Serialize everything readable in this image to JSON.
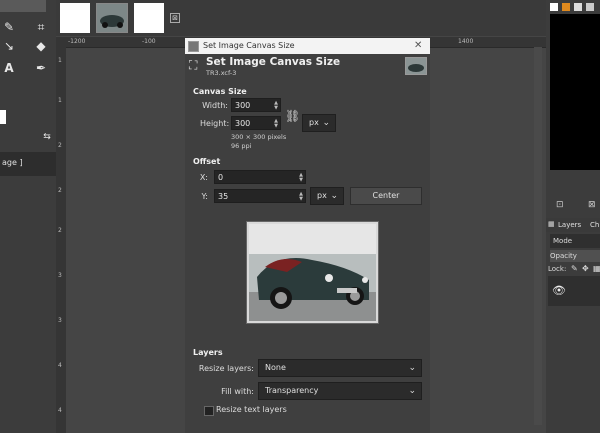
{
  "toolbox": {
    "tool_label": "age ]"
  },
  "tabs": {
    "close_glyph": "⊠"
  },
  "ruler": {
    "h_labels": [
      "-1200",
      "-100",
      "1400"
    ],
    "v_labels": [
      "1",
      "1",
      "2",
      "2",
      "2",
      "3",
      "3",
      "4",
      "4"
    ]
  },
  "right_panel": {
    "layers_tab": "Layers",
    "layers_tab_extra": "Ch",
    "mode_label": "Mode",
    "opacity_label": "Opacity",
    "lock_label": "Lock:"
  },
  "dialog": {
    "window_title": "Set Image Canvas Size",
    "header_title": "Set Image Canvas Size",
    "header_subtitle": "TR3.xcf-3",
    "canvas_size_section": "Canvas Size",
    "width_label": "Width:",
    "width_value": "300",
    "height_label": "Height:",
    "height_value": "300",
    "unit_value": "px",
    "size_info": "300 × 300 pixels",
    "ppi_info": "96 ppi",
    "offset_section": "Offset",
    "x_label": "X:",
    "x_value": "0",
    "y_label": "Y:",
    "y_value": "35",
    "offset_unit": "px",
    "center_button": "Center",
    "layers_section": "Layers",
    "resize_layers_label": "Resize layers:",
    "resize_layers_value": "None",
    "fill_with_label": "Fill with:",
    "fill_with_value": "Transparency",
    "resize_text_label": "Resize text layers"
  },
  "colors": {
    "background": "#454545",
    "dialog_bg": "#3f3f3f",
    "titlebar": "#f3f3f3",
    "field_bg": "#252525"
  }
}
